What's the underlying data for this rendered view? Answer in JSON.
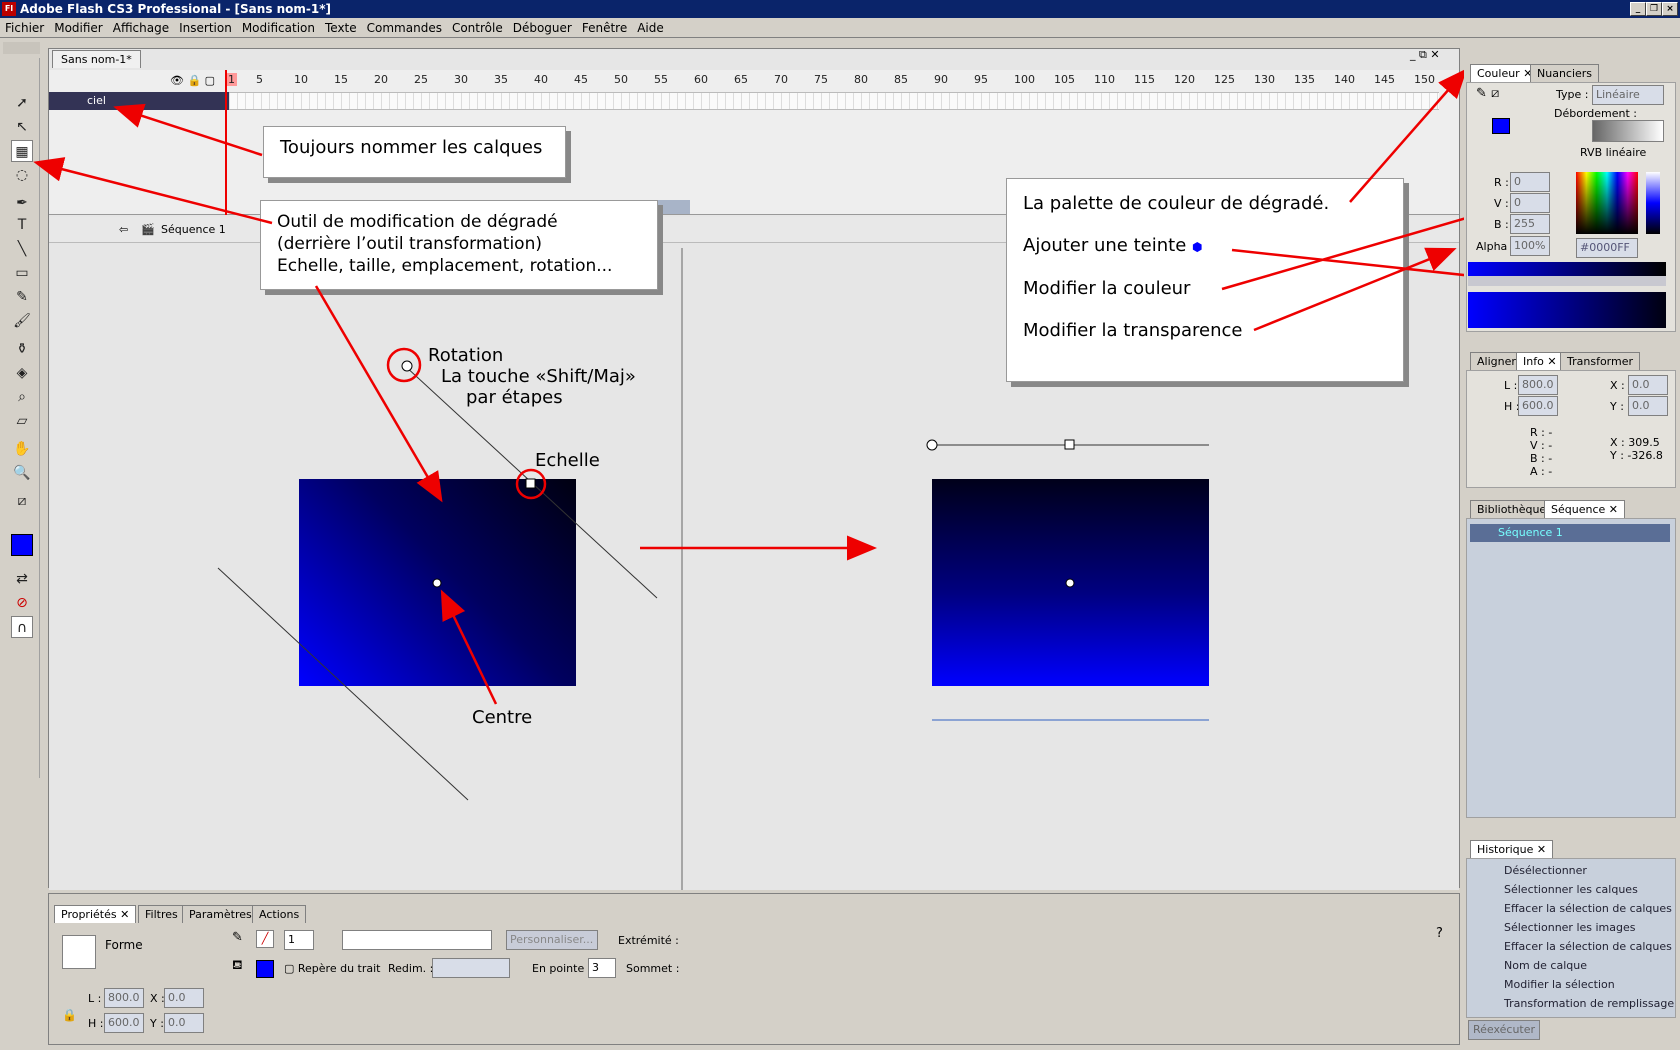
{
  "window": {
    "title": "Adobe Flash CS3 Professional - [Sans nom-1*]",
    "app_icon": "Fl"
  },
  "menu": [
    "Fichier",
    "Modifier",
    "Affichage",
    "Insertion",
    "Modification",
    "Texte",
    "Commandes",
    "Contrôle",
    "Déboguer",
    "Fenêtre",
    "Aide"
  ],
  "document": {
    "tab": "Sans nom-1*",
    "layer_name": "ciel",
    "scene": "Séquence 1"
  },
  "ruler": [
    "1",
    "5",
    "10",
    "15",
    "20",
    "25",
    "30",
    "35",
    "40",
    "45",
    "50",
    "55",
    "60",
    "65",
    "70",
    "75",
    "80",
    "85",
    "90",
    "95",
    "100",
    "105",
    "110",
    "115",
    "120",
    "125",
    "130",
    "135",
    "140",
    "145",
    "150"
  ],
  "callouts": {
    "calques": "Toujours nommer les calques",
    "outil_l1": "Outil de modification de dégradé",
    "outil_l2": "(derrière l’outil transformation)",
    "outil_l3": "Echelle, taille, emplacement, rotation...",
    "palette": "La palette de couleur de dégradé.",
    "teinte": "Ajouter une teinte",
    "couleur": "Modifier la couleur",
    "transparence": "Modifier la transparence"
  },
  "annotations": {
    "rotation": "Rotation",
    "shift": "La touche «Shift/Maj»",
    "etapes": "par étapes",
    "echelle": "Echelle",
    "centre": "Centre"
  },
  "color_panel": {
    "tabs": [
      "Couleur",
      "Nuanciers"
    ],
    "type_label": "Type :",
    "type_value": "Linéaire",
    "overflow_label": "Débordement :",
    "rgb_linear": "RVB linéaire",
    "r_label": "R :",
    "r": "0",
    "v_label": "V :",
    "v": "0",
    "b_label": "B :",
    "b": "255",
    "alpha_label": "Alpha :",
    "alpha": "100%",
    "hex": "#0000FF"
  },
  "info_panel": {
    "tabs": [
      "Aligner",
      "Info",
      "Transformer"
    ],
    "l_label": "L :",
    "l": "800.0",
    "h_label": "H :",
    "h": "600.0",
    "x_label": "X :",
    "x": "0.0",
    "y_label": "Y :",
    "y": "0.0",
    "r": "R : -",
    "v": "V : -",
    "b": "B : -",
    "a": "A : -",
    "cx": "X : 309.5",
    "cy": "Y : -326.8"
  },
  "library_panel": {
    "tabs": [
      "Bibliothèque",
      "Séquence"
    ],
    "item": "Séquence 1"
  },
  "history_panel": {
    "tab": "Historique",
    "items": [
      "Désélectionner",
      "Sélectionner les calques",
      "Effacer la sélection de calques",
      "Sélectionner les images",
      "Effacer la sélection de calques",
      "Nom de calque",
      "Modifier la sélection",
      "Transformation de remplissage"
    ],
    "redo": "Réexécuter"
  },
  "properties": {
    "tabs": [
      "Propriétés",
      "Filtres",
      "Paramètres",
      "Actions"
    ],
    "shape": "Forme",
    "stroke_size": "1",
    "custom_btn": "Personnaliser...",
    "extremite": "Extrémité :",
    "stroke_hint": "Repère du trait",
    "redim": "Redim. :",
    "en_pointe": "En pointe :",
    "en_pointe_val": "3",
    "sommet": "Sommet :",
    "l_label": "L :",
    "l": "800.0",
    "h_label": "H :",
    "h": "600.0",
    "x_label": "X :",
    "x": "0.0",
    "y_label": "Y :",
    "y": "0.0"
  },
  "colors": {
    "title_bg": "#0a246a",
    "gradient_start": "#0000ff",
    "gradient_end": "#000022",
    "arrow": "#e00000"
  }
}
